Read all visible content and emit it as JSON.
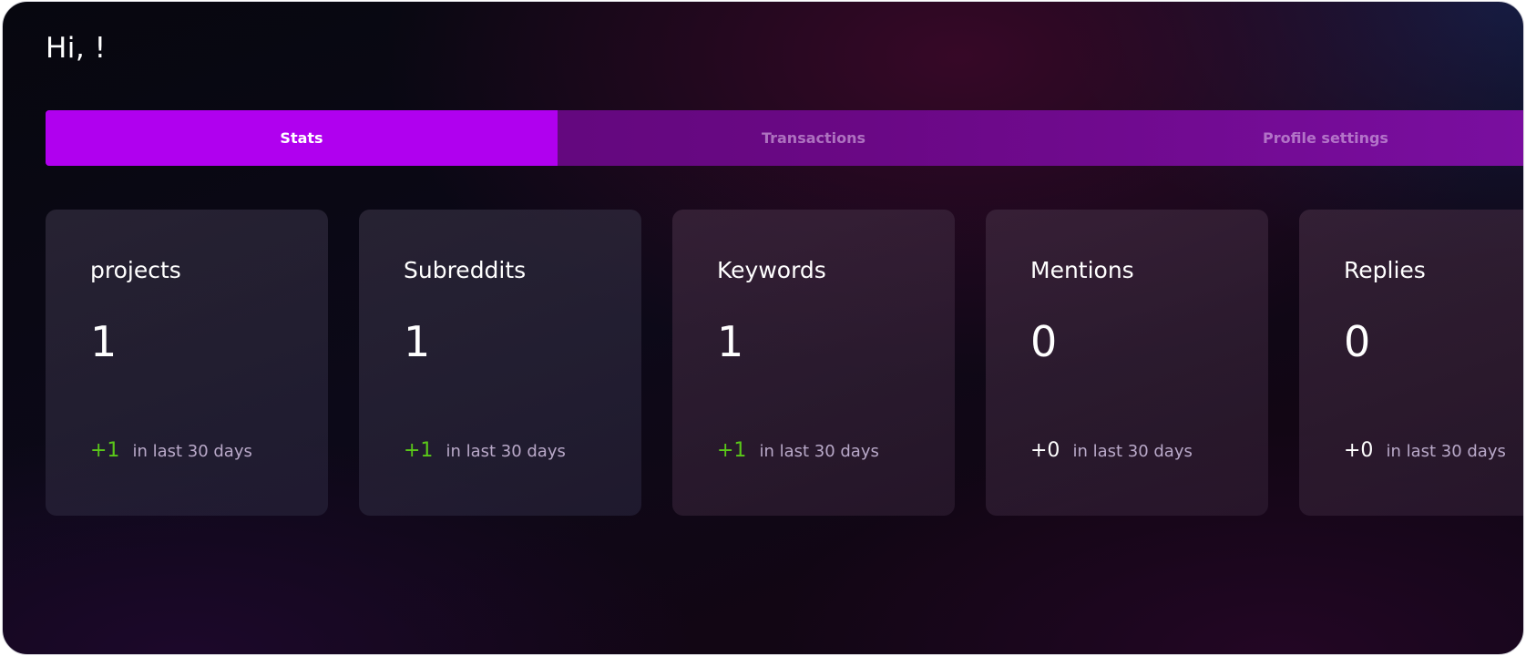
{
  "greeting": "Hi, !",
  "tabs": [
    {
      "label": "Stats",
      "active": true
    },
    {
      "label": "Transactions",
      "active": false
    },
    {
      "label": "Profile settings",
      "active": false
    }
  ],
  "cards": [
    {
      "title": "projects",
      "value": "1",
      "delta": "+1",
      "period": "in last 30 days"
    },
    {
      "title": "Subreddits",
      "value": "1",
      "delta": "+1",
      "period": "in last 30 days"
    },
    {
      "title": "Keywords",
      "value": "1",
      "delta": "+1",
      "period": "in last 30 days"
    },
    {
      "title": "Mentions",
      "value": "0",
      "delta": "+0",
      "period": "in last 30 days"
    },
    {
      "title": "Replies",
      "value": "0",
      "delta": "+0",
      "period": "in last 30 days"
    }
  ],
  "colors": {
    "accent": "#b000ef",
    "positive_delta": "#5ac819",
    "tab_bar": "#6a0885"
  }
}
